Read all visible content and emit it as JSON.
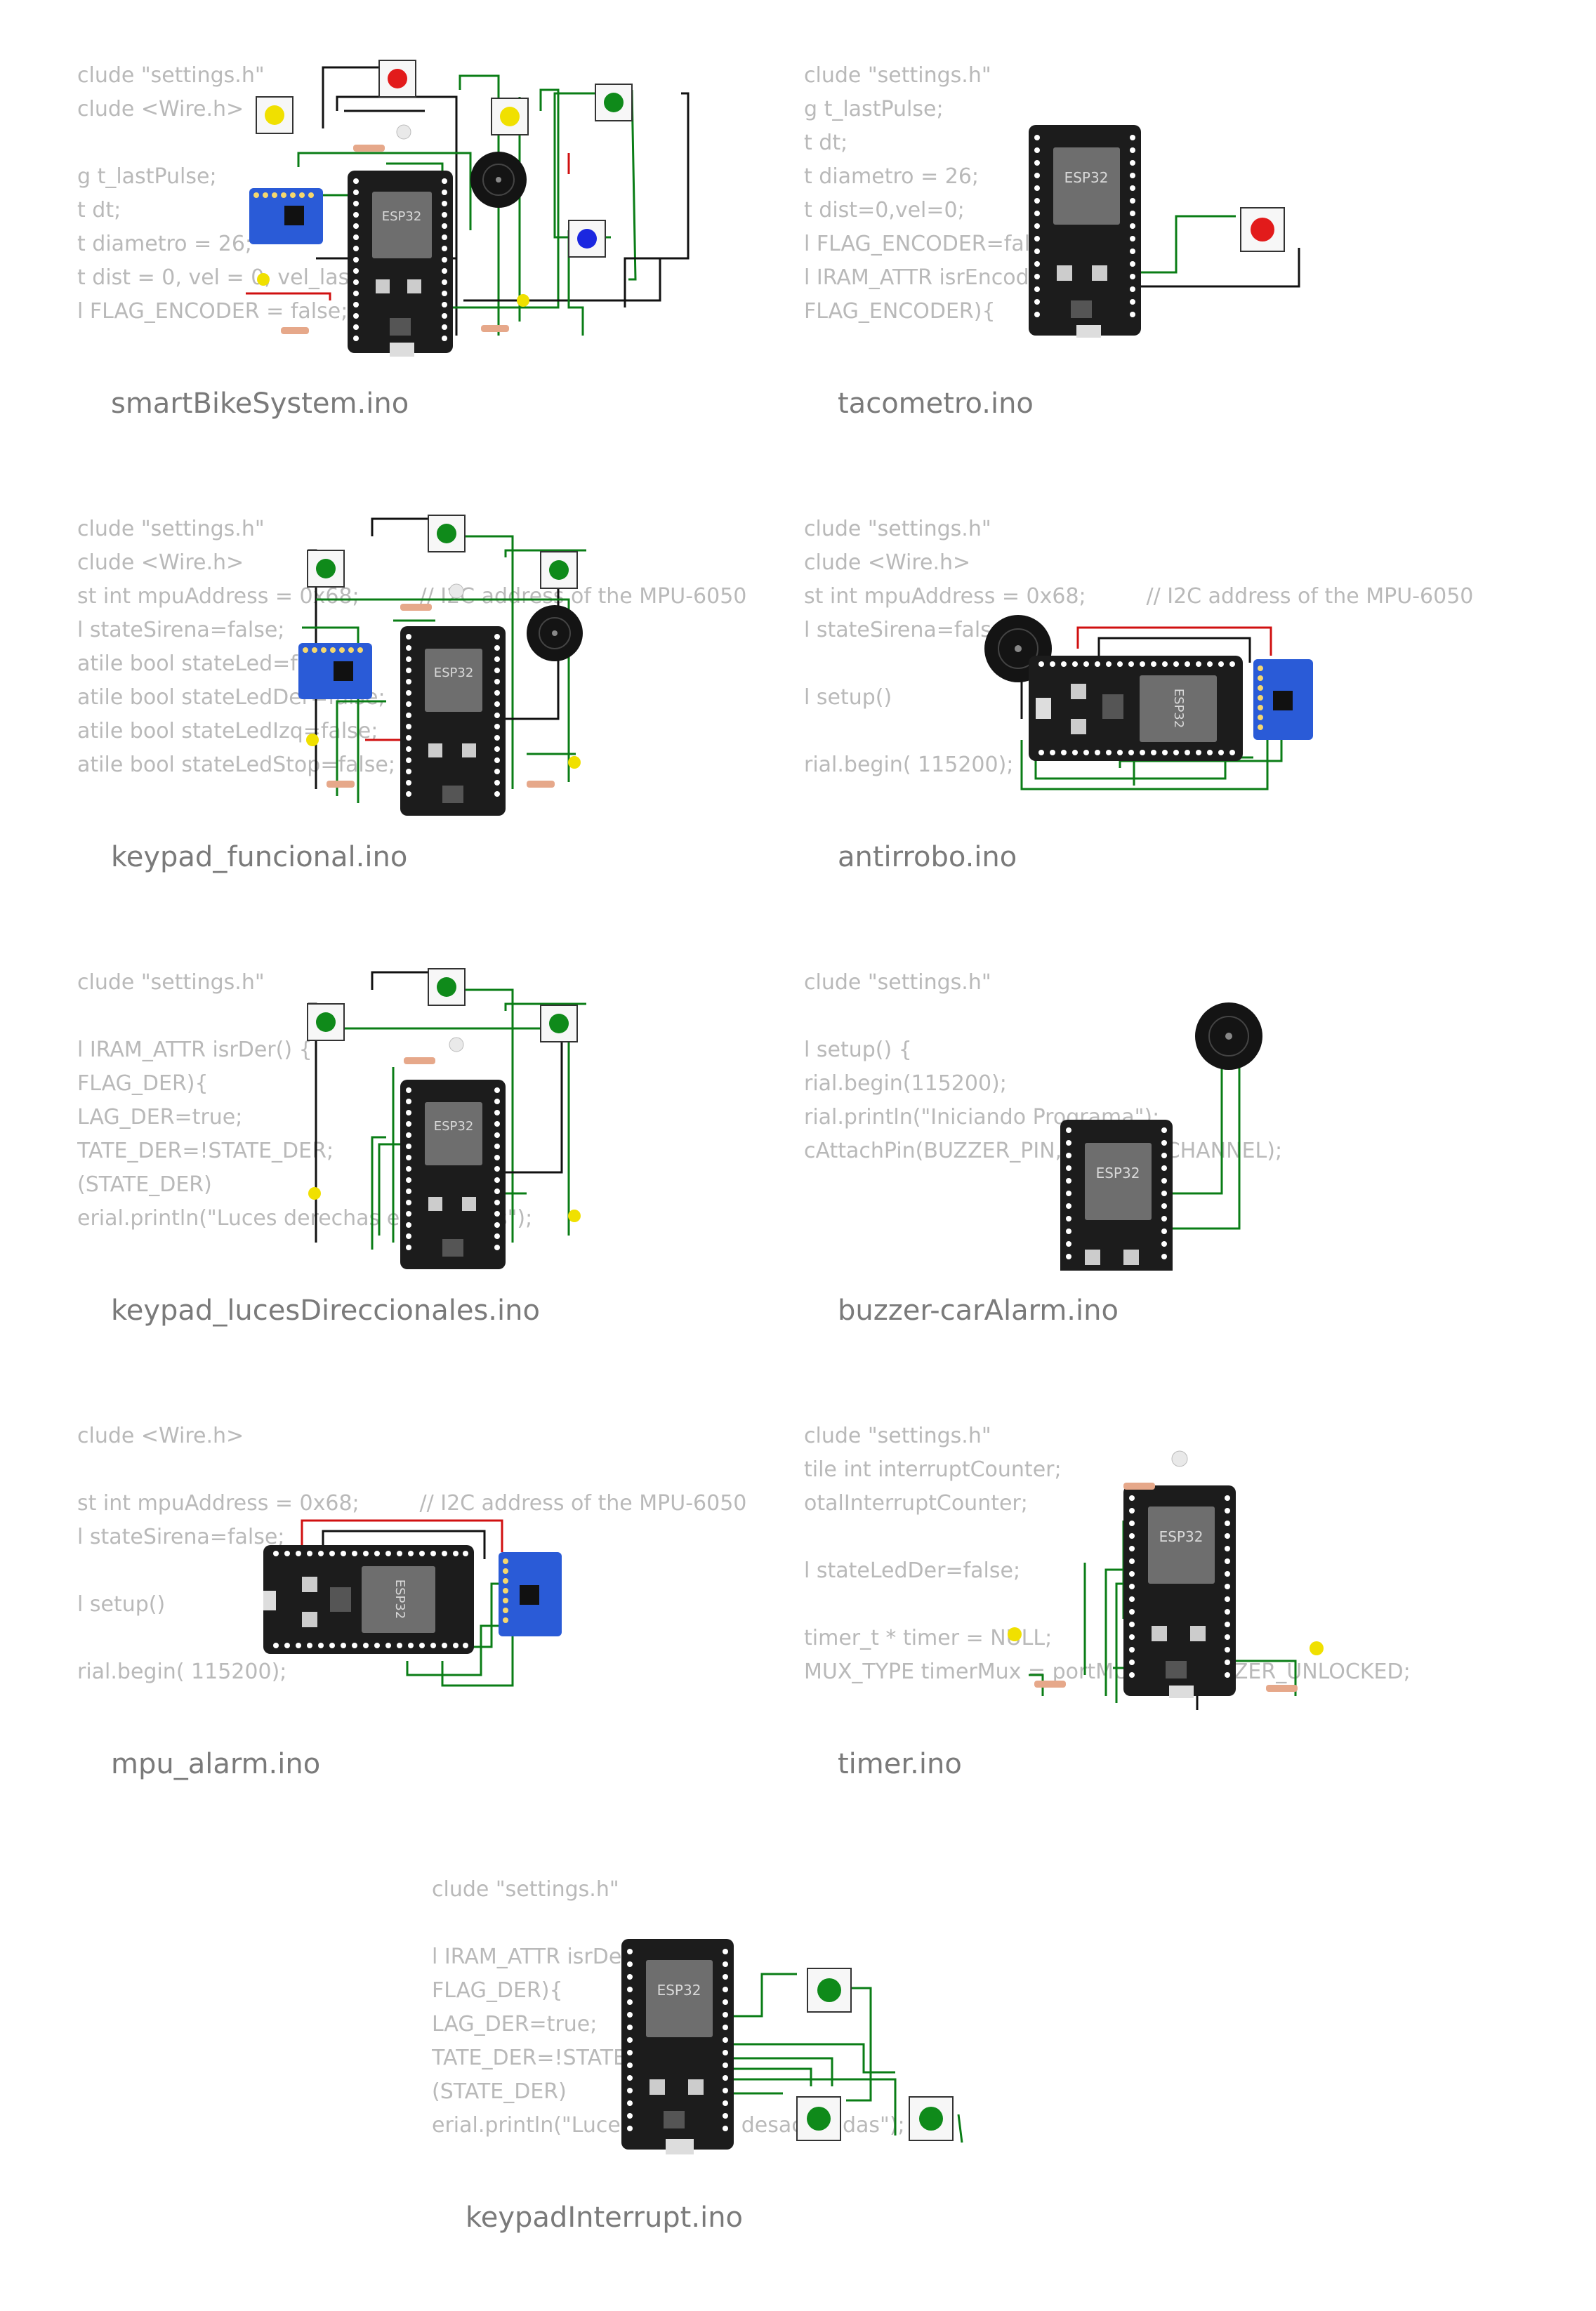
{
  "board_label": "ESP32",
  "colors": {
    "board": "#1c1c1c",
    "chip": "#6e6e6e",
    "wire_green": "#0a7d16",
    "wire_black": "#111111",
    "wire_red": "#d01010",
    "button_red": "#e21b1b",
    "button_green": "#0f8a1a",
    "button_yellow": "#f0e000",
    "button_blue": "#1b27e0",
    "sensor_blue": "#2a5bd7",
    "code_text": "#b9b9b9",
    "title_text": "#7a7a7a"
  },
  "projects": [
    {
      "title": "smartBikeSystem.ino",
      "code": [
        "clude \"settings.h\"",
        "clude <Wire.h>",
        "",
        "g t_lastPulse;",
        "t dt;",
        "t diametro = 26;",
        "t dist = 0, vel = 0, vel_last",
        "l FLAG_ENCODER = false;"
      ],
      "components": [
        "button-red",
        "button-yellow",
        "button-yellow",
        "button-green",
        "button-blue",
        "buzzer",
        "mpu6050",
        "leds",
        "resistors"
      ]
    },
    {
      "title": "tacometro.ino",
      "code": [
        "clude \"settings.h\"",
        "g t_lastPulse;",
        "t dt;",
        "t diametro = 26;",
        "t dist=0,vel=0;",
        "l FLAG_ENCODER=false;",
        "l IRAM_ATTR isrEncoder",
        "FLAG_ENCODER){"
      ],
      "components": [
        "button-red"
      ]
    },
    {
      "title": "keypad_funcional.ino",
      "code": [
        "clude \"settings.h\"",
        "clude <Wire.h>",
        "st int mpuAddress = 0x68;         // I2C address of the MPU-6050",
        "l stateSirena=false;",
        "atile bool stateLed=false;",
        "atile bool stateLedDer=false;",
        "atile bool stateLedIzq=false;",
        "atile bool stateLedStop=false;"
      ],
      "components": [
        "button-green",
        "button-green",
        "button-green",
        "buzzer",
        "mpu6050",
        "leds",
        "resistors"
      ]
    },
    {
      "title": "antirrobo.ino",
      "code": [
        "clude \"settings.h\"",
        "clude <Wire.h>",
        "st int mpuAddress = 0x68;         // I2C address of the MPU-6050",
        "l stateSirena=false;",
        "",
        "l setup()",
        "",
        "rial.begin( 115200);"
      ],
      "components": [
        "buzzer",
        "mpu6050"
      ]
    },
    {
      "title": "keypad_lucesDireccionales.ino",
      "code": [
        "clude \"settings.h\"",
        "",
        "l IRAM_ATTR isrDer() {",
        "FLAG_DER){",
        "LAG_DER=true;",
        "TATE_DER=!STATE_DER;",
        "(STATE_DER)",
        "erial.println(\"Luces derechas encendidas\");"
      ],
      "components": [
        "button-green",
        "button-green",
        "button-green",
        "leds",
        "resistors"
      ]
    },
    {
      "title": "buzzer-carAlarm.ino",
      "code": [
        "clude \"settings.h\"",
        "",
        "l setup() {",
        "rial.begin(115200);",
        "rial.println(\"Iniciando Programa\");",
        "cAttachPin(BUZZER_PIN, BUZZER_CHANNEL);",
        "",
        ""
      ],
      "components": [
        "buzzer"
      ]
    },
    {
      "title": "mpu_alarm.ino",
      "code": [
        "clude <Wire.h>",
        "",
        "st int mpuAddress = 0x68;         // I2C address of the MPU-6050",
        "l stateSirena=false;",
        "",
        "l setup()",
        "",
        "rial.begin( 115200);"
      ],
      "components": [
        "mpu6050"
      ]
    },
    {
      "title": "timer.ino",
      "code": [
        "clude \"settings.h\"",
        "tile int interruptCounter;",
        "otalInterruptCounter;",
        "",
        "l stateLedDer=false;",
        "",
        "timer_t * timer = NULL;",
        "MUX_TYPE timerMux = portMUX_INITIALIZER_UNLOCKED;"
      ],
      "components": [
        "leds",
        "resistors"
      ]
    },
    {
      "title": "keypadInterrupt.ino",
      "code": [
        "clude \"settings.h\"",
        "",
        "l IRAM_ATTR isrDer() {",
        "FLAG_DER){",
        "LAG_DER=true;",
        "TATE_DER=!STATE_DER;",
        "(STATE_DER)",
        "erial.println(\"Luces derechas desactivadas\");"
      ],
      "components": [
        "button-green",
        "button-green",
        "button-green"
      ]
    }
  ]
}
